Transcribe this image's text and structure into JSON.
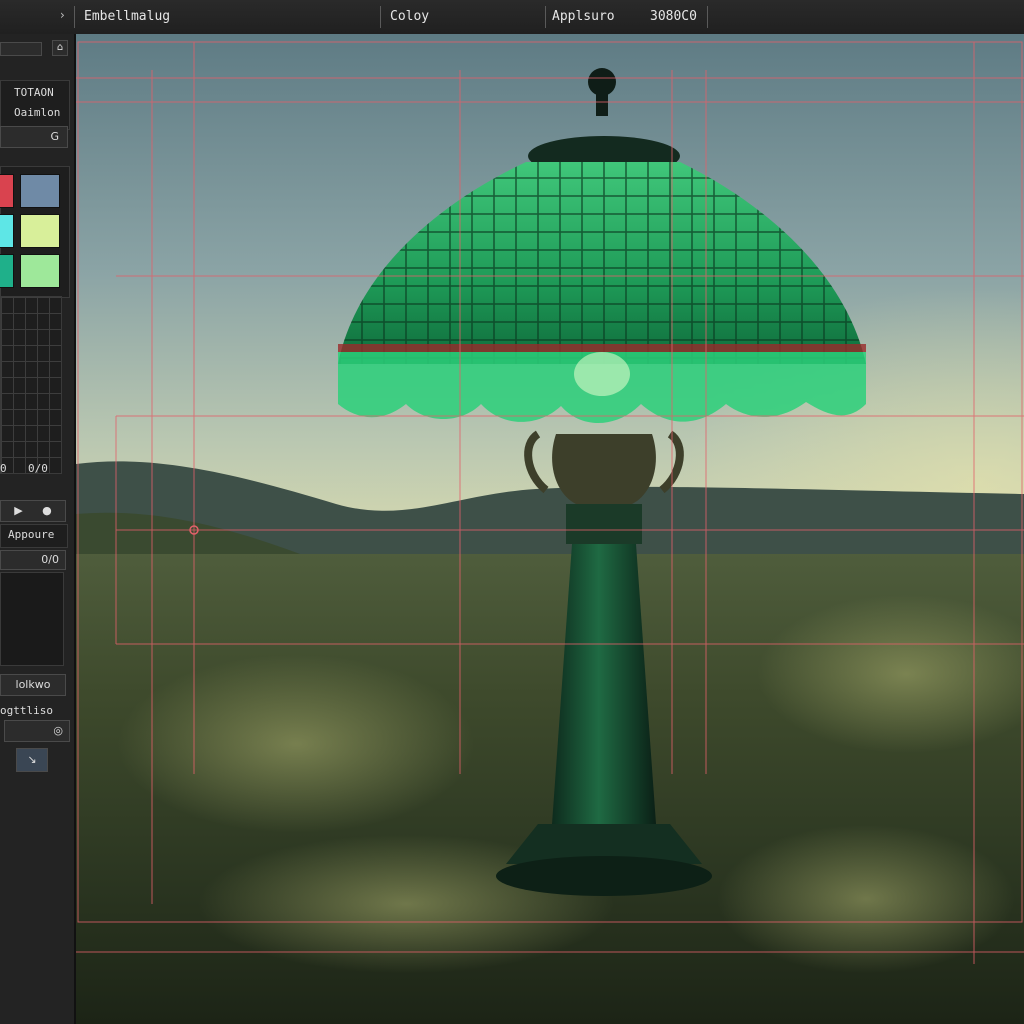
{
  "toolbar": {
    "left_chevron": "›",
    "layer_name": "Embellmalug",
    "color_label": "Coloy",
    "field_label": "Applsuro",
    "hex_value": "3080C0"
  },
  "sidebar": {
    "title1": "TOTAON",
    "title2": "Oaimlon",
    "field_icon": "G",
    "swatches": [
      {
        "color": "#d9434f"
      },
      {
        "color": "#6f8aa6"
      },
      {
        "color": "#5ee6e6"
      },
      {
        "color": "#d8ef9a"
      },
      {
        "color": "#1fb08a"
      },
      {
        "color": "#9ee89a"
      }
    ],
    "grid_values": [
      "0",
      "0/0"
    ],
    "play_icon": "▶",
    "record_icon": "●",
    "apply_label": "Appoure",
    "value_field": "0/0",
    "button_label": "lolkwo",
    "section_label": "ogttliso",
    "target_icon": "◎",
    "pen_icon": "↘"
  }
}
